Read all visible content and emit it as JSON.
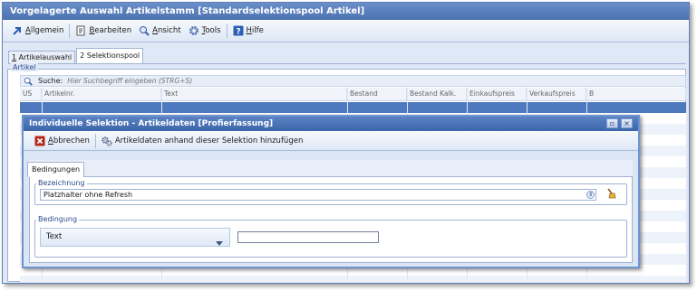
{
  "window": {
    "title": "Vorgelagerte Auswahl Artikelstamm [Standardselektionspool Artikel]"
  },
  "menu": [
    {
      "name": "menu-allgemein",
      "pre": "",
      "key": "A",
      "post": "llgemein",
      "icon": "arrow-icon"
    },
    {
      "name": "menu-bearbeiten",
      "pre": "",
      "key": "B",
      "post": "earbeiten",
      "icon": "document-icon"
    },
    {
      "name": "menu-ansicht",
      "pre": "",
      "key": "A",
      "post": "nsicht",
      "icon": "magnifier-icon"
    },
    {
      "name": "menu-tools",
      "pre": "",
      "key": "T",
      "post": "ools",
      "icon": "gear-icon"
    },
    {
      "name": "menu-hilfe",
      "pre": "",
      "key": "H",
      "post": "ilfe",
      "icon": "help-icon"
    }
  ],
  "tabs": [
    {
      "num": "1",
      "label": " Artikelauswahl"
    },
    {
      "num": "2",
      "label": " Selektionspool"
    }
  ],
  "group": {
    "legend": "Artikel"
  },
  "search": {
    "label": "Suche:",
    "placeholder": "Hier Suchbegriff eingeben (STRG+S)"
  },
  "grid": {
    "columns": [
      "US",
      "Artikelnr.",
      "Text",
      "Bestand",
      "Bestand Kalk.",
      "Einkaufspreis",
      "Verkaufspreis",
      "B"
    ]
  },
  "dialog": {
    "title": "Individuelle Selektion - Artikeldaten [Profierfassung]",
    "cancel_pre": "",
    "cancel_key": "A",
    "cancel_post": "bbrechen",
    "add_label": "Artikeldaten anhand dieser Selektion hinzufügen",
    "tab": "Bedingungen",
    "bezeichnung_legend": "Bezeichnung",
    "bezeichnung_value": "Platzhalter ohne Refresh",
    "bedingung_legend": "Bedingung",
    "bedingung_value": "Text",
    "bedingung_text": ""
  },
  "colors": {
    "title": "#4b71b0",
    "selection": "#4f79bf",
    "accent": "#6f93cf"
  }
}
